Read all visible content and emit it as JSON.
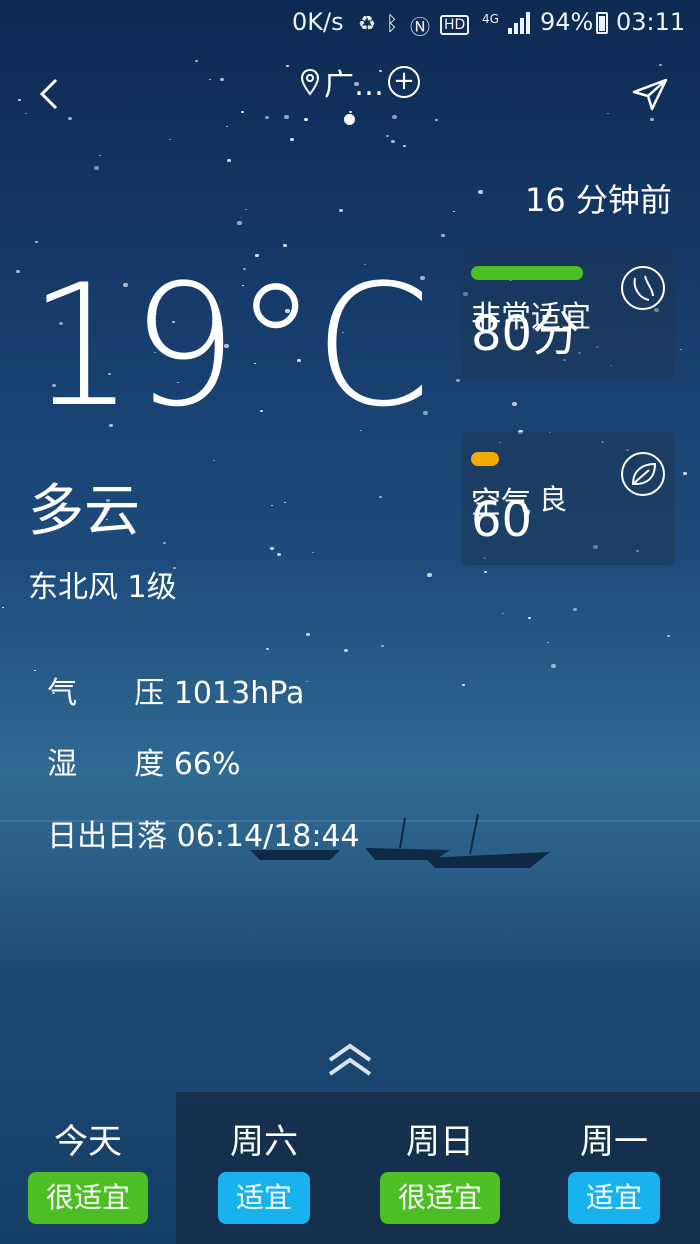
{
  "status_bar": {
    "net_speed": "0K/s",
    "network": "4G",
    "battery": "94%",
    "time": "03:11",
    "icons": [
      "recycle-icon",
      "bluetooth-icon",
      "nfc-icon",
      "hd-icon",
      "signal-icon",
      "battery-icon"
    ]
  },
  "header": {
    "location": "广…",
    "add_symbol": "+",
    "icons": [
      "back-icon",
      "location-pin-icon",
      "add-circle-icon",
      "share-icon"
    ]
  },
  "updated": "16 分钟前",
  "current": {
    "temperature": "19°C",
    "condition": "多云",
    "wind": "东北风 1级",
    "pressure_label": "气      压",
    "pressure_value": "1013hPa",
    "humidity_label": "湿      度",
    "humidity_value": "66%",
    "sun_label": "日出日落",
    "sun_value": "06:14/18:44"
  },
  "cards": {
    "comfort": {
      "label": "非常适宜",
      "value": "80分",
      "bar_color": "#4dbf24",
      "level_fraction": 0.8,
      "icon": "comfort-icon"
    },
    "air": {
      "label": "空气",
      "level": "良",
      "value": "60",
      "bar_color": "#f2a900",
      "level_fraction": 0.2,
      "icon": "leaf-icon"
    }
  },
  "expand_icon": "double-chevron-up-icon",
  "forecast": [
    {
      "day": "今天",
      "tag": "很适宜",
      "tag_color": "#4dbf24"
    },
    {
      "day": "周六",
      "tag": "适宜",
      "tag_color": "#18b2ef"
    },
    {
      "day": "周日",
      "tag": "很适宜",
      "tag_color": "#4dbf24"
    },
    {
      "day": "周一",
      "tag": "适宜",
      "tag_color": "#18b2ef"
    }
  ]
}
